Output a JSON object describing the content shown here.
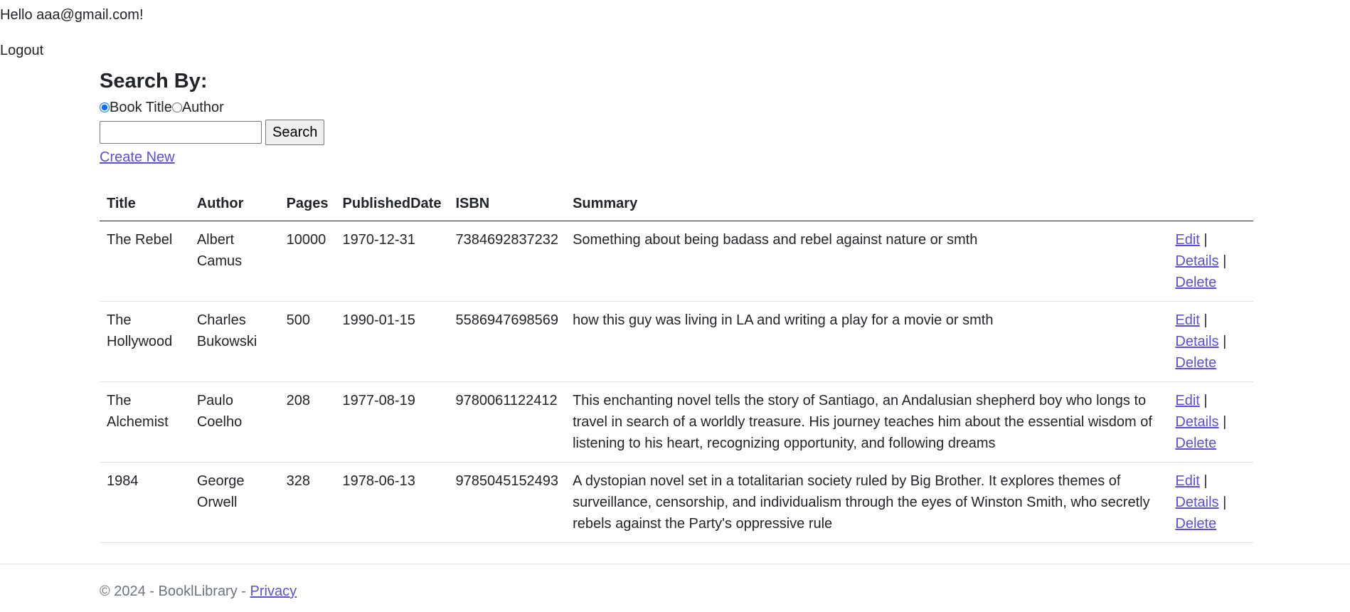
{
  "header": {
    "greeting": "Hello aaa@gmail.com!",
    "logout_label": "Logout"
  },
  "search": {
    "heading": "Search By:",
    "options": [
      {
        "label": "Book Title",
        "checked": true
      },
      {
        "label": "Author",
        "checked": false
      }
    ],
    "query_value": "",
    "button_label": "Search"
  },
  "create_new_label": "Create New",
  "table": {
    "headers": [
      "Title",
      "Author",
      "Pages",
      "PublishedDate",
      "ISBN",
      "Summary",
      ""
    ],
    "rows": [
      {
        "title": "The Rebel",
        "author": "Albert Camus",
        "pages": "10000",
        "published": "1970-12-31",
        "isbn": "7384692837232",
        "summary": "Something about being badass and rebel against nature or smth"
      },
      {
        "title": "The Hollywood",
        "author": "Charles Bukowski",
        "pages": "500",
        "published": "1990-01-15",
        "isbn": "5586947698569",
        "summary": "how this guy was living in LA and writing a play for a movie or smth"
      },
      {
        "title": "The Alchemist",
        "author": "Paulo Coelho",
        "pages": "208",
        "published": "1977-08-19",
        "isbn": "9780061122412",
        "summary": "This enchanting novel tells the story of Santiago, an Andalusian shepherd boy who longs to travel in search of a worldly treasure. His journey teaches him about the essential wisdom of listening to his heart, recognizing opportunity, and following dreams"
      },
      {
        "title": "1984",
        "author": "George Orwell",
        "pages": "328",
        "published": "1978-06-13",
        "isbn": "9785045152493",
        "summary": "A dystopian novel set in a totalitarian society ruled by Big Brother. It explores themes of surveillance, censorship, and individualism through the eyes of Winston Smith, who secretly rebels against the Party's oppressive rule"
      }
    ],
    "actions": {
      "edit": "Edit",
      "details": "Details",
      "delete": "Delete",
      "separator": " |"
    }
  },
  "footer": {
    "text": "© 2024 - BooklLibrary - ",
    "privacy_label": "Privacy"
  },
  "colors": {
    "link": "#5b4fd6",
    "text": "#212529",
    "muted": "#6c757d"
  }
}
